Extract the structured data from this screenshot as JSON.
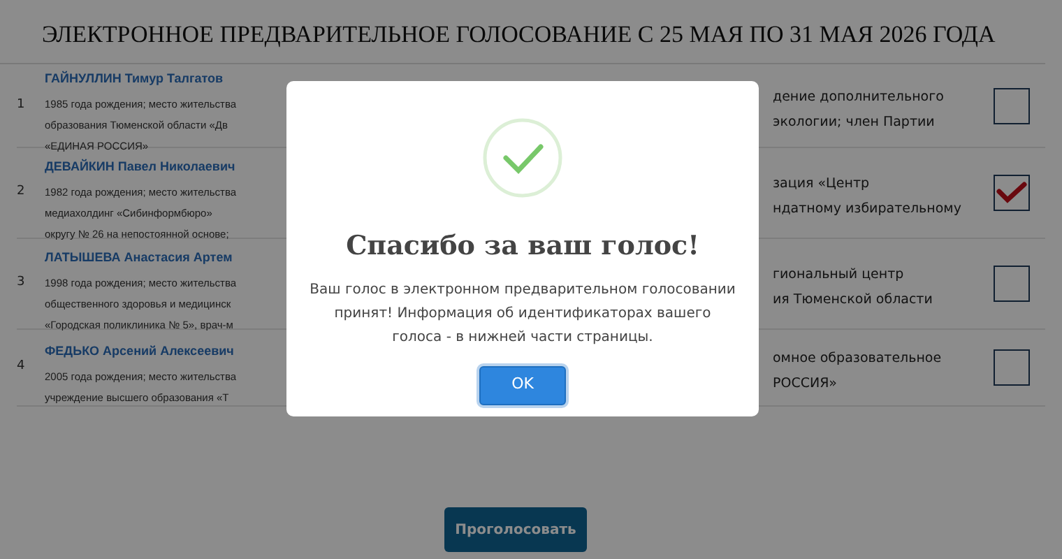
{
  "header": {
    "title": "ЭЛЕКТРОННОЕ ПРЕДВАРИТЕЛЬНОЕ ГОЛОСОВАНИЕ С 25 МАЯ ПО 31 МАЯ 2026 ГОДА"
  },
  "candidates": [
    {
      "number": "1",
      "name": "ГАЙНУЛЛИН Тимур Талгатов",
      "details_left": [
        "1985 года рождения; место жительства",
        "образования Тюменской области «Дв",
        "«ЕДИНАЯ РОССИЯ»"
      ],
      "details_right": [
        "дение дополнительного",
        "экологии; член Партии"
      ],
      "checked": false
    },
    {
      "number": "2",
      "name": "ДЕВАЙКИН Павел Николаевич",
      "details_left": [
        "1982 года рождения; место жительства",
        "медиахолдинг «Сибинформбюро»",
        "округу № 26 на непостоянной основе;"
      ],
      "details_right": [
        "зация «Центр",
        "ндатному избирательному"
      ],
      "checked": true
    },
    {
      "number": "3",
      "name": "ЛАТЫШЕВА Анастасия Артем",
      "details_left": [
        "1998 года рождения; место жительства",
        "общественного здоровья и медицинск",
        "«Городская поликлиника № 5», врач-м"
      ],
      "details_right": [
        "гиональный центр",
        "ия Тюменской области"
      ],
      "checked": false
    },
    {
      "number": "4",
      "name": "ФЕДЬКО Арсений Алексеевич",
      "details_left": [
        "2005 года рождения; место жительства",
        "учреждение высшего образования «Т"
      ],
      "details_right": [
        "омное образовательное",
        "РОССИЯ»"
      ],
      "checked": false
    }
  ],
  "vote_button": {
    "label": "Проголосовать"
  },
  "modal": {
    "title": "Спасибо за ваш голос!",
    "message": "Ваш голос в электронном предварительном голосовании принят! Информация об идентификаторах вашего голоса - в нижней части страницы.",
    "ok_button": "OK"
  }
}
